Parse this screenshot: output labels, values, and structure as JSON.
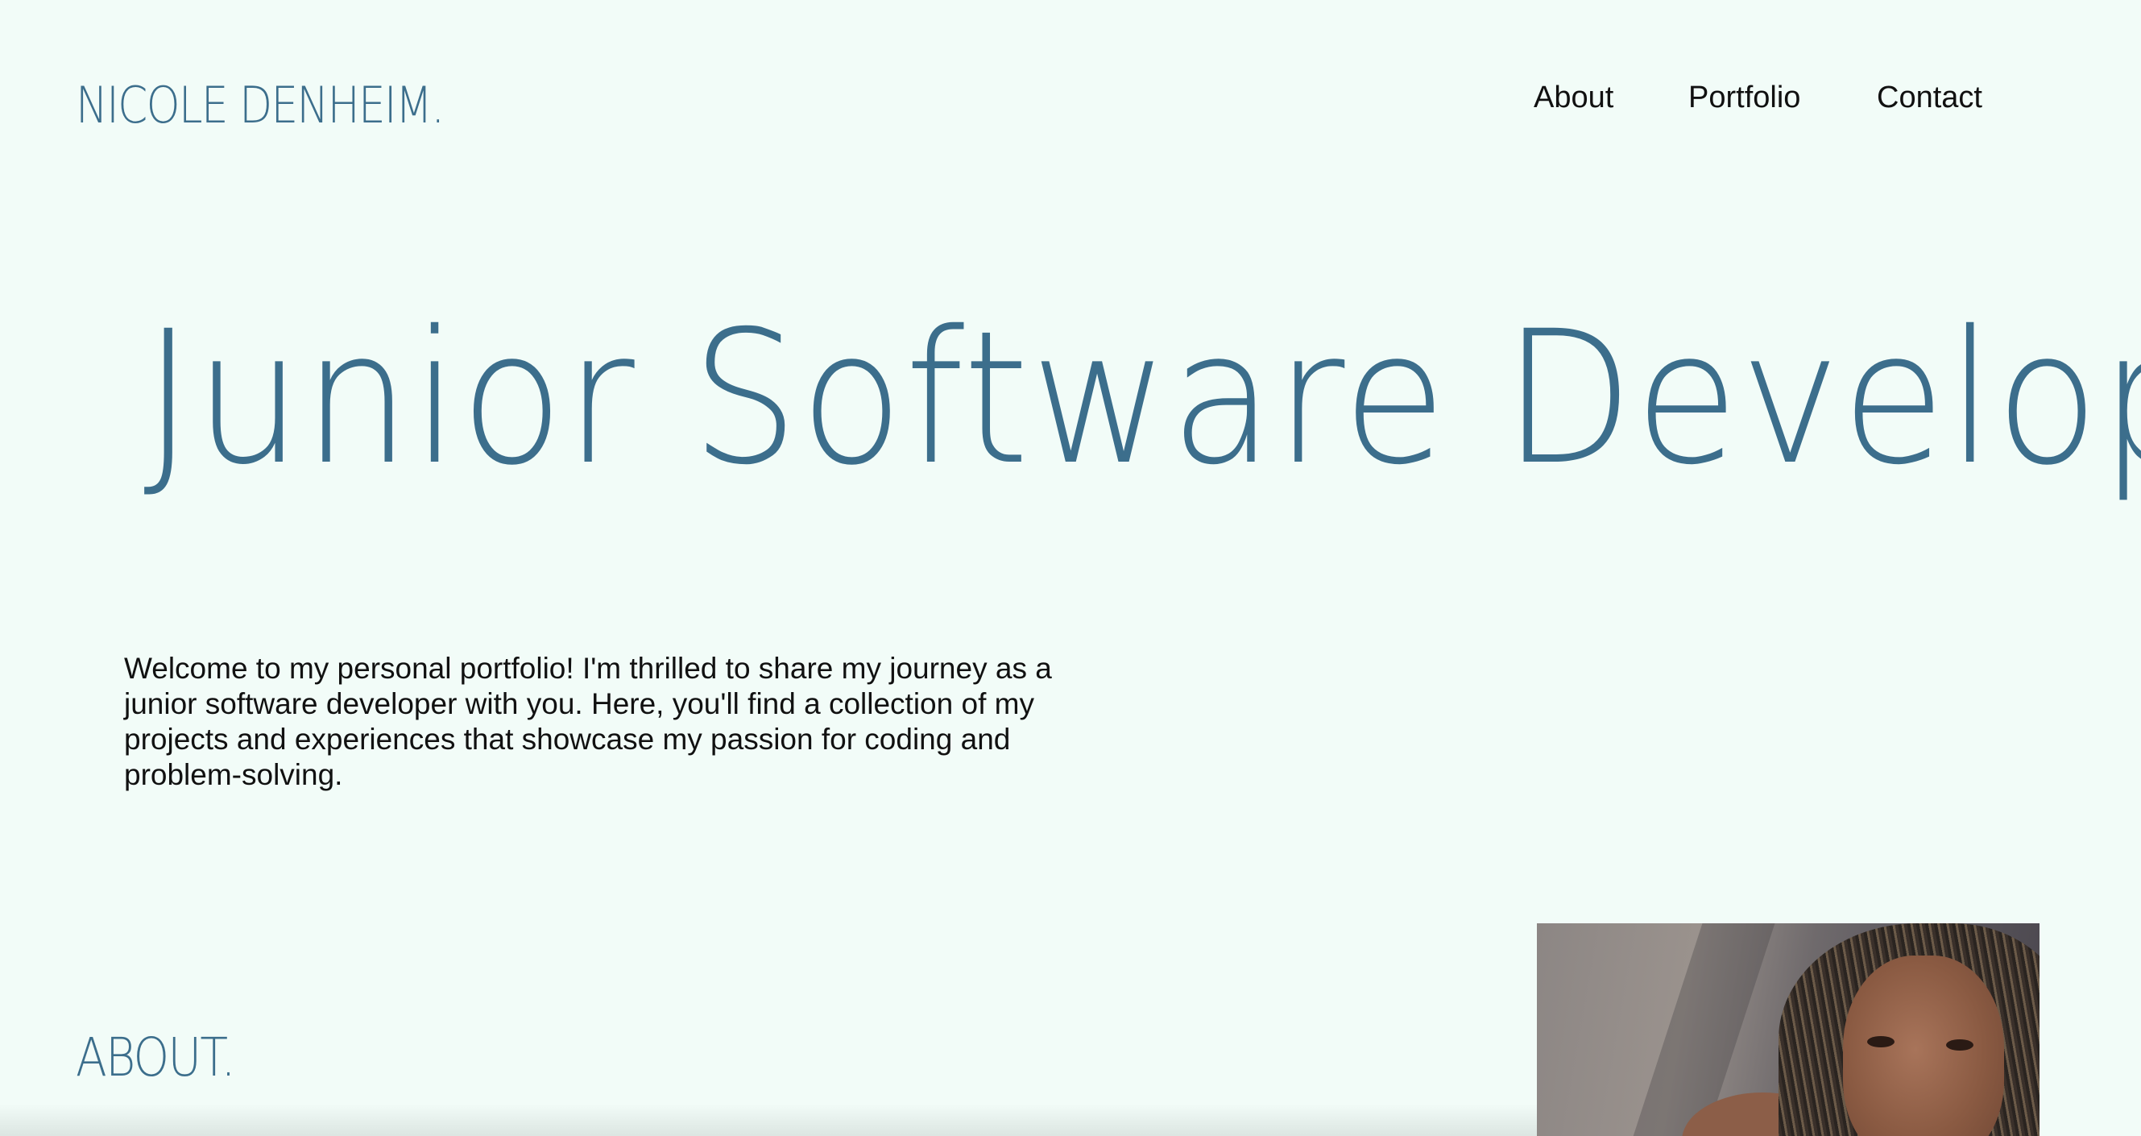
{
  "header": {
    "brand": "NICOLE DENHEIM.",
    "nav": [
      {
        "label": "About"
      },
      {
        "label": "Portfolio"
      },
      {
        "label": "Contact"
      }
    ]
  },
  "hero": {
    "title": "Junior Software Developer.",
    "intro": "Welcome to my personal portfolio! I'm thrilled to share my journey as a junior software developer with you. Here, you'll find a collection of my projects and experiences that showcase my passion for coding and problem-solving."
  },
  "about": {
    "heading": "ABOUT."
  },
  "colors": {
    "background": "#f2fcf8",
    "accent": "#3c6e8c",
    "text": "#111111"
  }
}
